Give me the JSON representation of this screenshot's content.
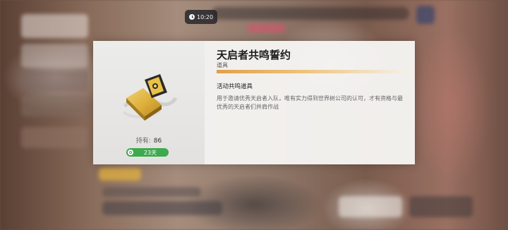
{
  "status": {
    "time": "10:20"
  },
  "item": {
    "name": "天启者共鸣誓约",
    "type": "道具",
    "category": "活动共鸣道具",
    "description": "用于邀请优秀天启者入队，唯有实力得到世界树公司的认可，才有资格与最优秀的天启者们并肩作战",
    "owned_label": "持有:",
    "owned_count": "86",
    "duration": "23天",
    "rarity_color": "#e0a04a",
    "duration_color": "#3daa4e",
    "icon": "gold-card-icon"
  }
}
